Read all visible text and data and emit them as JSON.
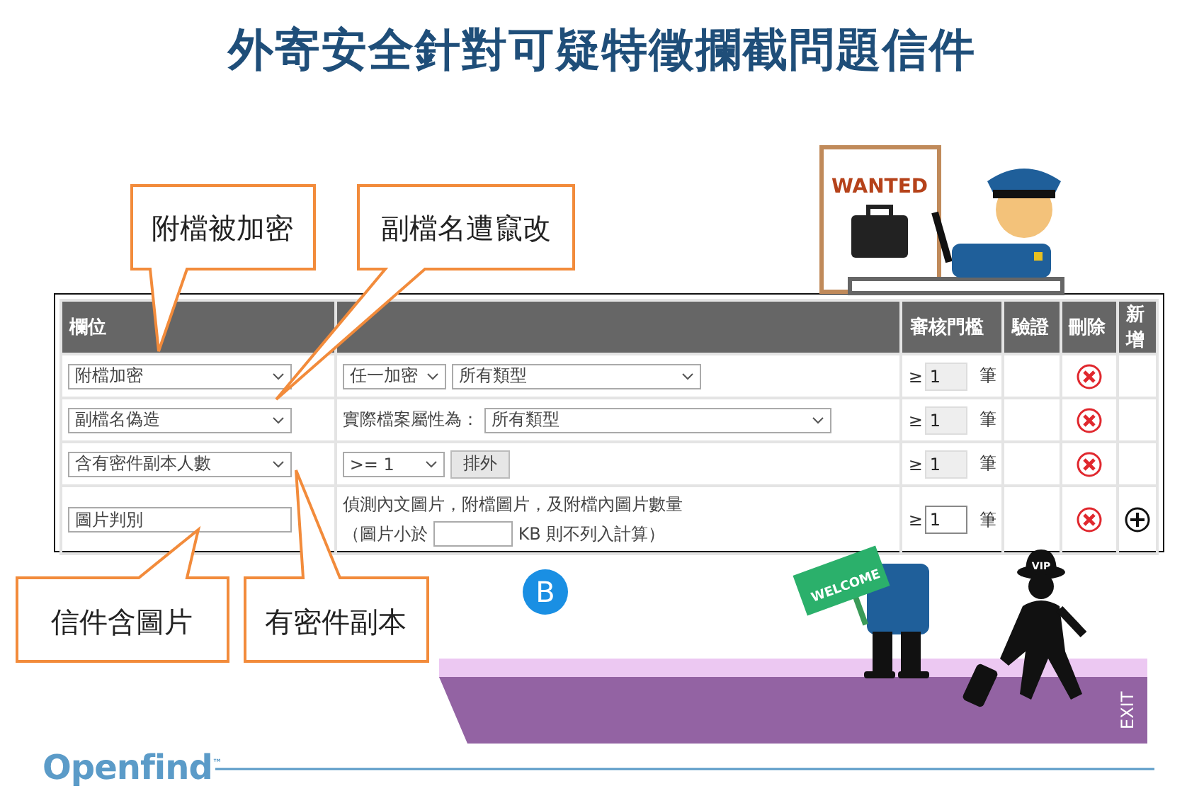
{
  "title": "外寄安全針對可疑特徵攔截問題信件",
  "table": {
    "columns": [
      {
        "label": "欄位"
      },
      {
        "kind": "blank"
      },
      {
        "label": "審核門檻"
      },
      {
        "label": "驗證"
      },
      {
        "label": "刪除"
      },
      {
        "label": "新增"
      }
    ],
    "rows": [
      {
        "field": {
          "kind": "select",
          "value": "附檔加密"
        },
        "condition": [
          [
            {
              "kind": "select",
              "value": "任一加密"
            },
            {
              "kind": "select",
              "value": "所有類型"
            }
          ]
        ],
        "threshold": {
          "prefix": "≥",
          "value": "1",
          "unit": "筆",
          "disabled": true
        },
        "delete": true,
        "add": false
      },
      {
        "field": {
          "kind": "select",
          "value": "副檔名偽造"
        },
        "condition": [
          [
            {
              "kind": "text",
              "value": "實際檔案屬性為："
            },
            {
              "kind": "select",
              "value": "所有類型",
              "wide": true
            }
          ]
        ],
        "threshold": {
          "prefix": "≥",
          "value": "1",
          "unit": "筆",
          "disabled": true
        },
        "delete": true,
        "add": false
      },
      {
        "field": {
          "kind": "select",
          "value": "含有密件副本人數"
        },
        "condition": [
          [
            {
              "kind": "select",
              "value": ">= 1"
            },
            {
              "kind": "button",
              "value": "排外"
            }
          ]
        ],
        "threshold": {
          "prefix": "≥",
          "value": "1",
          "unit": "筆",
          "disabled": true
        },
        "delete": true,
        "add": false
      },
      {
        "field": {
          "kind": "input",
          "value": "圖片判別"
        },
        "condition": [
          [
            {
              "kind": "text",
              "value": "偵測內文圖片，附檔圖片，及附檔內圖片數量"
            }
          ],
          [
            {
              "kind": "text",
              "value": "（圖片小於"
            },
            {
              "kind": "input"
            },
            {
              "kind": "text",
              "value": "KB 則不列入計算）"
            }
          ]
        ],
        "threshold": {
          "prefix": "≥",
          "value": "1",
          "unit": "筆",
          "disabled": false
        },
        "delete": true,
        "add": true
      }
    ]
  },
  "callouts": [
    {
      "text": "附檔被加密"
    },
    {
      "text": "副檔名遭竄改"
    },
    {
      "text": "信件含圖片"
    },
    {
      "text": "有密件副本"
    }
  ],
  "badge": "B",
  "illustration": {
    "poster": "WANTED",
    "sign": "WELCOME",
    "hat": "VIP",
    "door": "EXIT"
  },
  "logo": "Openfind$^{™}$"
}
